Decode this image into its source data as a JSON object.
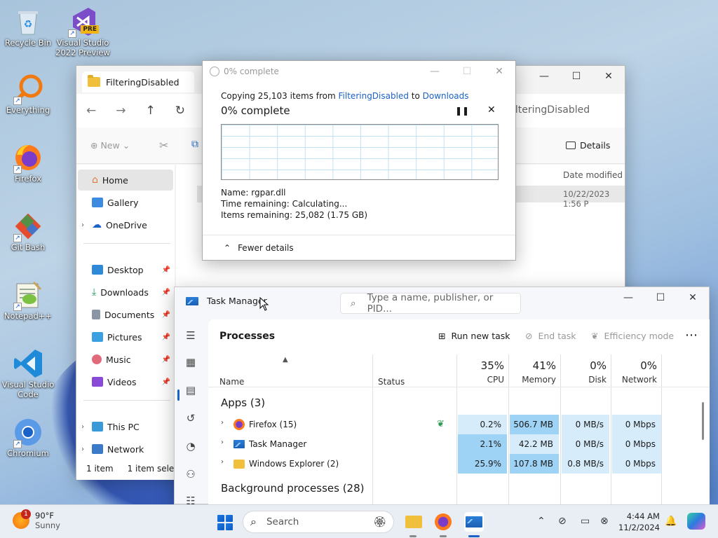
{
  "desktop": {
    "icons": [
      {
        "label": "Recycle Bin"
      },
      {
        "label": "Visual Studio 2022 Preview",
        "line1": "Visual Studio",
        "line2": "2022 Preview",
        "badge": "PRE"
      },
      {
        "label": "Everything"
      },
      {
        "label": "Firefox"
      },
      {
        "label": "Git Bash"
      },
      {
        "label": "Notepad++"
      },
      {
        "label": "Visual Studio Code",
        "line1": "Visual Studio",
        "line2": "Code"
      },
      {
        "label": "Chromium"
      }
    ]
  },
  "explorer": {
    "tab_title": "FilteringDisabled",
    "address": "ilteringDisabled",
    "toolbar": {
      "new_label": "New",
      "details_label": "Details"
    },
    "sidebar": [
      {
        "label": "Home",
        "active": true
      },
      {
        "label": "Gallery"
      },
      {
        "label": "OneDrive",
        "expandable": true
      },
      {
        "label": "Desktop",
        "pinned": true
      },
      {
        "label": "Downloads",
        "pinned": true
      },
      {
        "label": "Documents",
        "pinned": true
      },
      {
        "label": "Pictures",
        "pinned": true
      },
      {
        "label": "Music",
        "pinned": true
      },
      {
        "label": "Videos",
        "pinned": true
      },
      {
        "label": "This PC",
        "expandable": true
      },
      {
        "label": "Network",
        "expandable": true
      }
    ],
    "column_date_modified": "Date modified",
    "row_date": "10/22/2023 1:56 P",
    "status": {
      "items": "1 item",
      "selected": "1 item selecte"
    }
  },
  "copy_dialog": {
    "title": "0% complete",
    "copying_prefix": "Copying 25,103 items from ",
    "from": "FilteringDisabled",
    "to_word": " to ",
    "to": "Downloads",
    "percent_text": "0% complete",
    "name_line": "Name:  rgpar.dll",
    "time_line": "Time remaining:  Calculating...",
    "items_line": "Items remaining:  25,082 (1.75 GB)",
    "fewer_details": "Fewer details",
    "progress": 0
  },
  "task_manager": {
    "title": "Task Manager",
    "search_placeholder": "Type a name, publisher, or PID...",
    "page_heading": "Processes",
    "actions": {
      "run_new_task": "Run new task",
      "end_task": "End task",
      "efficiency_mode": "Efficiency mode"
    },
    "columns": {
      "name": "Name",
      "status": "Status",
      "cpu": {
        "pct": "35%",
        "label": "CPU"
      },
      "memory": {
        "pct": "41%",
        "label": "Memory"
      },
      "disk": {
        "pct": "0%",
        "label": "Disk"
      },
      "network": {
        "pct": "0%",
        "label": "Network"
      }
    },
    "apps_group": "Apps (3)",
    "background_group": "Background processes (28)",
    "processes": [
      {
        "name": "Firefox (15)",
        "cpu": "0.2%",
        "memory": "506.7 MB",
        "disk": "0 MB/s",
        "network": "0 Mbps",
        "efficiency": true
      },
      {
        "name": "Task Manager",
        "cpu": "2.1%",
        "memory": "42.2 MB",
        "disk": "0 MB/s",
        "network": "0 Mbps"
      },
      {
        "name": "Windows Explorer (2)",
        "cpu": "25.9%",
        "memory": "107.8 MB",
        "disk": "0.8 MB/s",
        "network": "0 Mbps"
      }
    ]
  },
  "taskbar": {
    "weather": {
      "temp": "90°F",
      "condition": "Sunny",
      "badge": "1"
    },
    "search_label": "Search",
    "clock": {
      "time": "4:44 AM",
      "date": "11/2/2024"
    }
  },
  "colors": {
    "accent": "#1a62c8",
    "heat_strong": "#9fd3f5",
    "heat_light": "#d6ecfb"
  }
}
